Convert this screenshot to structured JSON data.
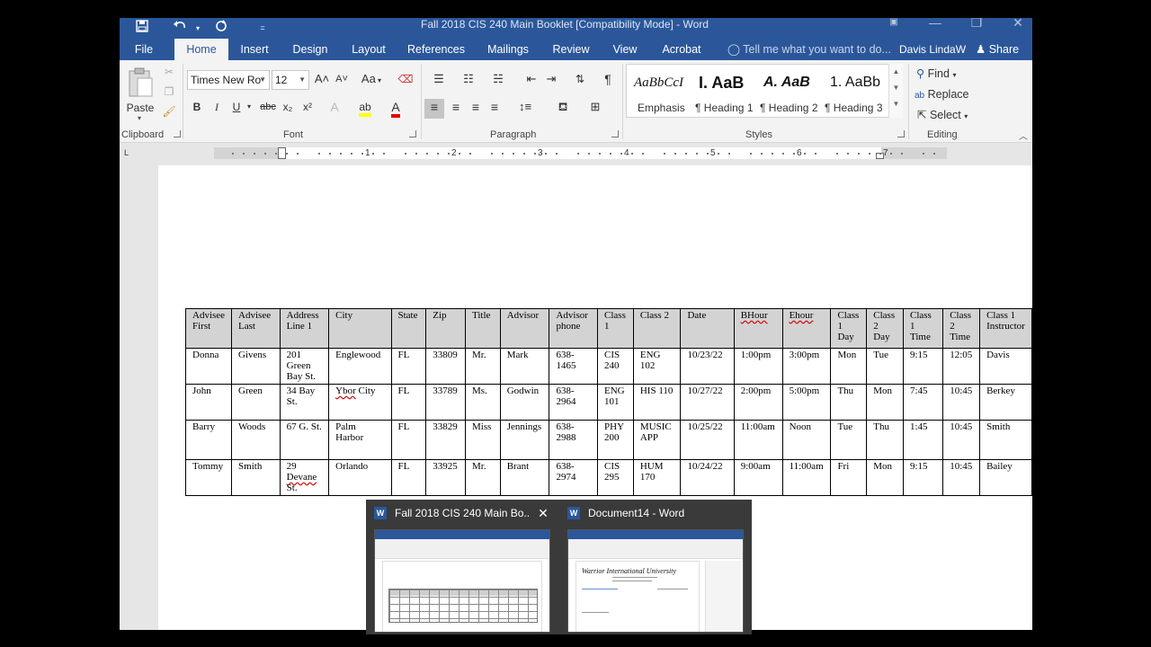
{
  "titlebar": {
    "title": "Fall 2018 CIS 240 Main Booklet [Compatibility Mode] - Word",
    "save_icon": "save-icon",
    "undo_icon": "undo-icon",
    "redo_icon": "repeat-icon",
    "minimize": "—",
    "restore": "❒",
    "close": "✕"
  },
  "tabs": [
    "File",
    "Home",
    "Insert",
    "Design",
    "Layout",
    "References",
    "Mailings",
    "Review",
    "View",
    "Acrobat"
  ],
  "active_tab": "Home",
  "tell_me": "Tell me what you want to do...",
  "user_name": "Davis LindaW",
  "share_label": "Share",
  "ribbon": {
    "clipboard": {
      "label": "Clipboard",
      "paste": "Paste"
    },
    "font": {
      "label": "Font",
      "family": "Times New Ro",
      "size": "12",
      "aa": "Aa",
      "bold": "B",
      "italic": "I",
      "underline": "U",
      "strike": "abc",
      "sub": "x₂",
      "sup": "x²",
      "grow": "A˄",
      "shrink": "A˅"
    },
    "paragraph": {
      "label": "Paragraph",
      "pilcrow": "¶"
    },
    "styles": {
      "label": "Styles",
      "items": [
        {
          "preview": "AaBbCcI",
          "name": "Emphasis"
        },
        {
          "preview": "I. AaB",
          "name": "¶ Heading 1"
        },
        {
          "preview": "A. AaB",
          "name": "¶ Heading 2"
        },
        {
          "preview": "1. AaBb",
          "name": "¶ Heading 3"
        }
      ]
    },
    "editing": {
      "label": "Editing",
      "find": "Find",
      "replace": "Replace",
      "select": "Select"
    }
  },
  "ruler": {
    "numbers": [
      "1",
      "2",
      "3",
      "4",
      "5",
      "6",
      "7"
    ],
    "tab_selector": "L"
  },
  "table": {
    "headers": [
      "Advisee First",
      "Advisee Last",
      "Address Line 1",
      "City",
      "State",
      "Zip",
      "Title",
      "Advisor",
      "Advisor phone",
      "Class 1",
      "Class 2",
      "Date",
      "BHour",
      "Ehour",
      "Class 1 Day",
      "Class 2 Day",
      "Class 1 Time",
      "Class 2 Time",
      "Class 1 Instructor"
    ],
    "rows": [
      [
        "Donna",
        "Givens",
        "201 Green Bay St.",
        "Englewood",
        "FL",
        "33809",
        "Mr.",
        "Mark",
        "638-1465",
        "CIS 240",
        "ENG 102",
        "10/23/22",
        "1:00pm",
        "3:00pm",
        "Mon",
        "Tue",
        "9:15",
        "12:05",
        "Davis"
      ],
      [
        "John",
        "Green",
        "34 Bay St.",
        "Ybor City",
        "FL",
        "33789",
        "Ms.",
        "Godwin",
        "638-2964",
        "ENG 101",
        "HIS 110",
        "10/27/22",
        "2:00pm",
        "5:00pm",
        "Thu",
        "Mon",
        "7:45",
        "10:45",
        "Berkey"
      ],
      [
        "Barry",
        "Woods",
        "67 G. St.",
        "Palm Harbor",
        "FL",
        "33829",
        "Miss",
        "Jennings",
        "638-2988",
        "PHY 200",
        "MUSIC APP",
        "10/25/22",
        "11:00am",
        "Noon",
        "Tue",
        "Thu",
        "1:45",
        "10:45",
        "Smith"
      ],
      [
        "Tommy",
        "Smith",
        "29 Devane St.",
        "Orlando",
        "FL",
        "33925",
        "Mr.",
        "Brant",
        "638-2974",
        "CIS 295",
        "HUM 170",
        "10/24/22",
        "9:00am",
        "11:00am",
        "Fri",
        "Mon",
        "9:15",
        "10:45",
        "Bailey"
      ]
    ]
  },
  "taskbar_preview": {
    "windows": [
      {
        "title": "Fall 2018 CIS 240 Main Bo...",
        "close": "✕"
      },
      {
        "title": "Document14 - Word"
      }
    ],
    "doc14_heading": "Warrior International University"
  },
  "colors": {
    "word_blue": "#2b579a",
    "ribbon_bg": "#f3f3f3",
    "header_fill": "#d3d3d3"
  }
}
